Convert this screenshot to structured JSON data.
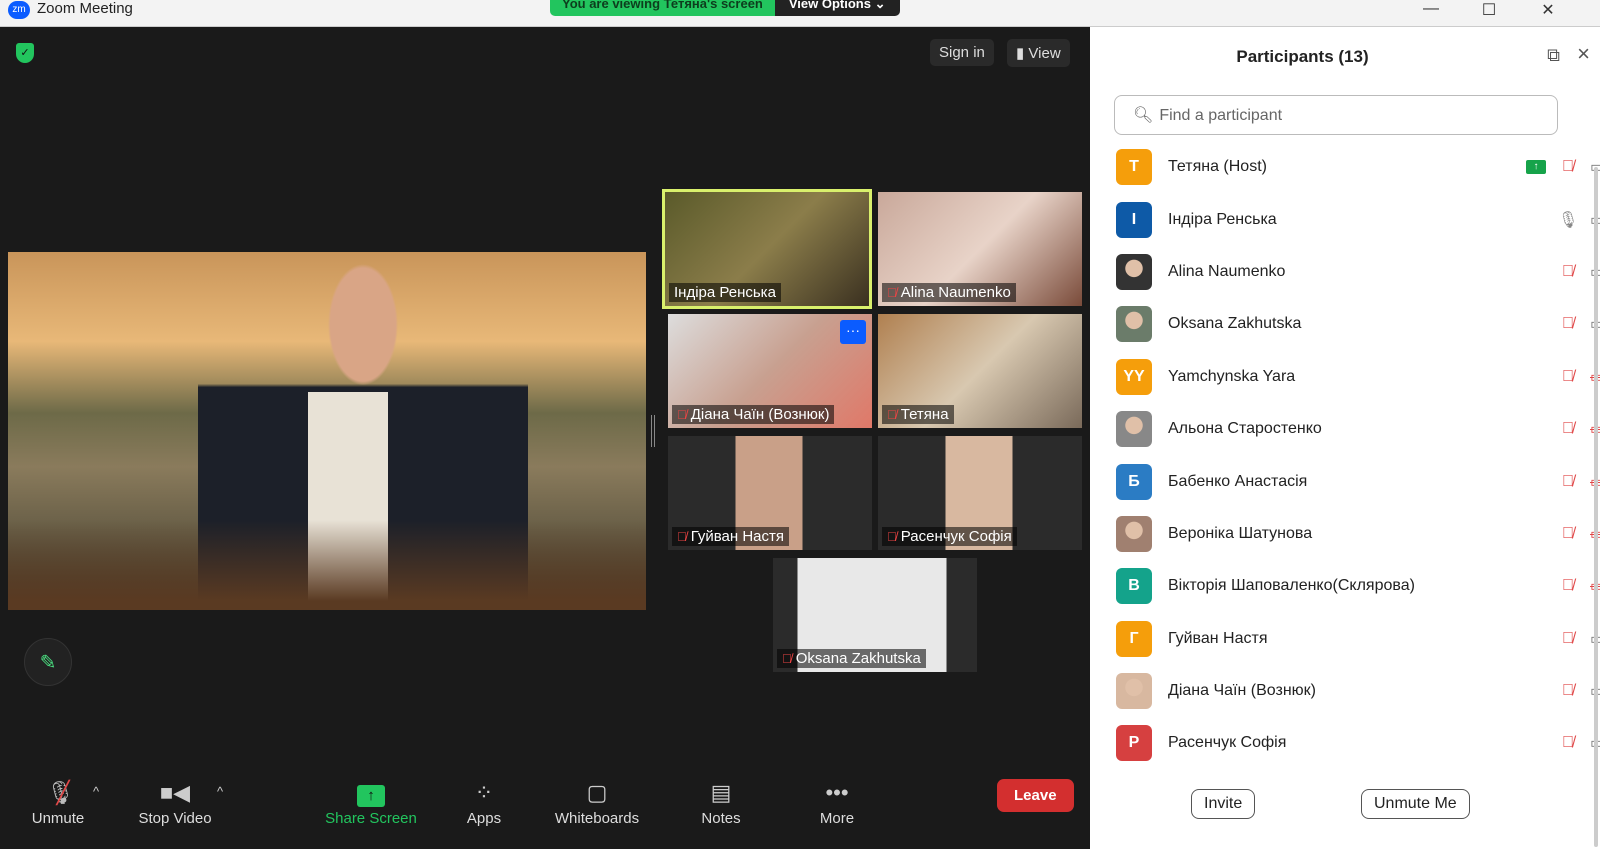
{
  "window": {
    "title": "Zoom Meeting",
    "logo": "zm",
    "minimize": "—",
    "maximize": "☐",
    "close": "✕"
  },
  "banner": {
    "viewing": "You are viewing Тетяна's screen",
    "view_options": "View Options",
    "chevron": "⌄"
  },
  "top": {
    "sign_in": "Sign in",
    "view": "View"
  },
  "tiles": [
    {
      "name": "Індіра Ренська",
      "muted": false,
      "active": true,
      "bg": "linear-gradient(135deg,#5a5a2a,#8b7d4a 50%,#3a3020)"
    },
    {
      "name": "Alina Naumenko",
      "muted": true,
      "bg": "linear-gradient(135deg,#c9a89a,#e8d3c8 50%,#7a4b3a)"
    },
    {
      "name": "Діана Чаїн (Вознюк)",
      "muted": true,
      "bg": "linear-gradient(135deg,#ddd,#c8a090 50%,#e07868)",
      "more": "···"
    },
    {
      "name": "Тетяна",
      "muted": true,
      "bg": "linear-gradient(135deg,#b08050,#d8c8b0 50%,#7a6a5a)"
    },
    {
      "name": "Гуйван Настя",
      "muted": true,
      "bg": "linear-gradient(90deg,#2b2b2b 33%,#c9a088 33% 66%,#2b2b2b 66%)"
    },
    {
      "name": "Расенчук Софія",
      "muted": true,
      "bg": "linear-gradient(90deg,#2b2b2b 33%,#d8b8a0 33% 66%,#2b2b2b 66%)"
    },
    {
      "name": "Oksana Zakhutska",
      "muted": true,
      "bg": "linear-gradient(90deg,#2b2b2b 12%,#e8e8e8 12% 85%,#2b2b2b 85%)"
    }
  ],
  "toolbar": {
    "unmute": "Unmute",
    "stop_video": "Stop Video",
    "share_screen": "Share Screen",
    "apps": "Apps",
    "whiteboards": "Whiteboards",
    "notes": "Notes",
    "more": "More",
    "leave": "Leave"
  },
  "panel": {
    "title": "Participants (13)",
    "search_placeholder": "Find a participant",
    "invite": "Invite",
    "unmute_me": "Unmute Me"
  },
  "participants": [
    {
      "name": "Тетяна (Host)",
      "initial": "T",
      "color": "#f59e0b",
      "sharing": true,
      "mic": "muted",
      "video": "on"
    },
    {
      "name": "Індіра Ренська",
      "initial": "I",
      "color": "#0e5aa7",
      "mic": "on",
      "video": "on"
    },
    {
      "name": "Alina Naumenko",
      "initial": "",
      "color": "#333333",
      "mic": "muted",
      "video": "on"
    },
    {
      "name": "Oksana Zakhutska",
      "initial": "",
      "color": "#6b7c6a",
      "mic": "muted",
      "video": "on"
    },
    {
      "name": "Yamchynska Yara",
      "initial": "YY",
      "color": "#f59e0b",
      "mic": "muted",
      "video": "off"
    },
    {
      "name": "Альона Старостенко",
      "initial": "",
      "color": "#888888",
      "mic": "muted",
      "video": "off"
    },
    {
      "name": "Бабенко Анастасія",
      "initial": "Б",
      "color": "#2b7cc4",
      "mic": "muted",
      "video": "off"
    },
    {
      "name": "Вероніка Шатунова",
      "initial": "",
      "color": "#a08070",
      "mic": "muted",
      "video": "off"
    },
    {
      "name": "Вікторія Шаповаленко(Склярова)",
      "initial": "В",
      "color": "#14a38b",
      "mic": "muted",
      "video": "off"
    },
    {
      "name": "Гуйван Настя",
      "initial": "Г",
      "color": "#f59e0b",
      "mic": "muted",
      "video": "on"
    },
    {
      "name": "Діана Чаїн (Вознюк)",
      "initial": "",
      "color": "#d8b8a0",
      "mic": "muted",
      "video": "on"
    },
    {
      "name": "Расенчук Софія",
      "initial": "Р",
      "color": "#d64040",
      "mic": "muted",
      "video": "on"
    }
  ]
}
